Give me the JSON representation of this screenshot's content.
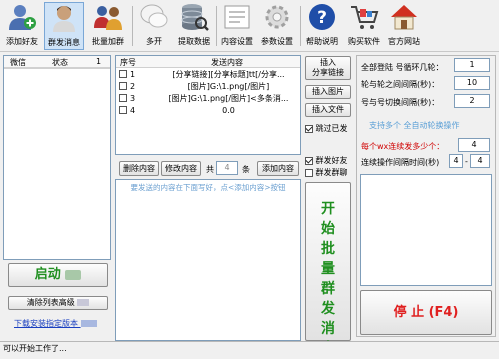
{
  "toolbar": {
    "items": [
      {
        "label": "添加好友",
        "icon": "add-friend-icon"
      },
      {
        "label": "群发消息",
        "icon": "mass-message-icon"
      },
      {
        "label": "批量加群",
        "icon": "batch-join-group-icon"
      },
      {
        "label": "多开",
        "icon": "multi-open-icon"
      },
      {
        "label": "提取数据",
        "icon": "extract-data-icon"
      },
      {
        "label": "内容设置",
        "icon": "content-settings-icon"
      },
      {
        "label": "参数设置",
        "icon": "parameter-settings-icon"
      },
      {
        "label": "帮助说明",
        "icon": "help-icon"
      },
      {
        "label": "购买软件",
        "icon": "buy-cart-icon"
      },
      {
        "label": "官方网站",
        "icon": "home-icon"
      }
    ]
  },
  "left": {
    "col_account": "微信",
    "col_status": "状态",
    "count": "1",
    "start_button": "启动",
    "clear_button": "清除列表高级",
    "download_link": "下载安装指定版本"
  },
  "content": {
    "col_no": "序号",
    "col_text": "发送内容",
    "rows": [
      {
        "no": "1",
        "text": "[分享链接][分享标题]tt[/分享..."
      },
      {
        "no": "2",
        "text": "[图片]G:\\1.png[/图片]"
      },
      {
        "no": "3",
        "text": "[图片]G:\\1.png[/图片]<多条消..."
      },
      {
        "no": "4",
        "text": "0.0"
      }
    ],
    "insert_share_link": "插入\n分享链接",
    "insert_image": "插入图片",
    "insert_file": "插入文件",
    "skip_sent_label": "跳过已发",
    "delete_button": "删除内容",
    "edit_button": "修改内容",
    "total_prefix": "共",
    "total_value": "4",
    "total_suffix": "条",
    "add_button": "添加内容",
    "editor_placeholder": "要发送的内容在下面写好，点<添加内容>按钮",
    "send_friends_label": "群发好友",
    "send_groups_label": "群发群聊",
    "start_send_button": "开始批量群发消息"
  },
  "settings": {
    "all_rounds_label": "全部登陆  号循环几轮：",
    "all_rounds_value": "1",
    "round_interval_label": "轮与轮之间间隔(秒)：",
    "round_interval_value": "10",
    "account_switch_label": "号与号切换间隔(秒)：",
    "account_switch_value": "2",
    "multi_note": "支持多个 全自动轮换操作",
    "per_account_label": "每个wx连续发多少个：",
    "per_account_value": "4",
    "interval_label": "连续操作间隔时间(秒)",
    "interval_min": "4",
    "interval_max": "4",
    "stop_button": "停  止 (F4)"
  },
  "status_bar": "可以开始工作了...",
  "colors": {
    "start_text": "#1f8f1f",
    "start_send_text": "#1f8f1f",
    "stop_text": "#e02020",
    "per_account_text": "#d00000",
    "note_text": "#5a9fd6",
    "link_text": "#1a3fc0"
  }
}
